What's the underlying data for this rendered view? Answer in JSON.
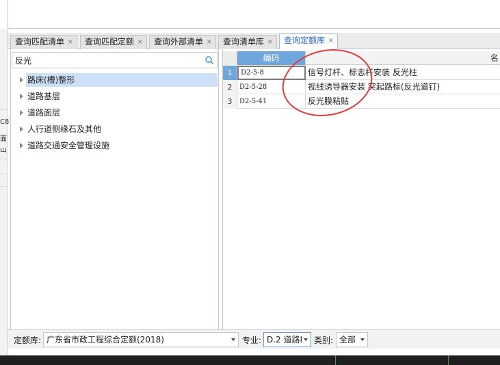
{
  "outer_strip": {
    "fragments": [
      "C8",
      "面",
      "щ"
    ]
  },
  "tabs": [
    {
      "label": "查询匹配清单",
      "close": "×"
    },
    {
      "label": "查询匹配定额",
      "close": "×"
    },
    {
      "label": "查询外部清单",
      "close": "×"
    },
    {
      "label": "查询清单库",
      "close": "×"
    },
    {
      "label": "查询定额库",
      "close": "×",
      "active": true
    }
  ],
  "search": {
    "value": "反光",
    "icon": "search-icon"
  },
  "tree": {
    "items": [
      {
        "label": "路床(槽)整形",
        "selected": true
      },
      {
        "label": "道路基层"
      },
      {
        "label": "道路面层"
      },
      {
        "label": "人行道侧缘石及其他"
      },
      {
        "label": "道路交通安全管理设施"
      }
    ]
  },
  "grid": {
    "columns": {
      "code": "编码",
      "name": "名"
    },
    "rows": [
      {
        "num": "1",
        "code": "D2-5-8",
        "name": "信号灯杆、标志杆安装 反光柱"
      },
      {
        "num": "2",
        "code": "D2-5-28",
        "name": "视线诱导器安装 突起路标(反光道钉)"
      },
      {
        "num": "3",
        "code": "D2-5-41",
        "name": "反光膜粘贴"
      }
    ]
  },
  "bottom": {
    "quota_label": "定额库:",
    "quota_value": "广东省市政工程综合定额(2018)",
    "major_label": "专业:",
    "major_value": "D.2 道路I",
    "category_label": "类别:",
    "category_value": "全部"
  },
  "colors": {
    "accent": "#2a6ad6",
    "header_blue": "#6fa7dd",
    "annotation_red": "#e23b3b"
  }
}
